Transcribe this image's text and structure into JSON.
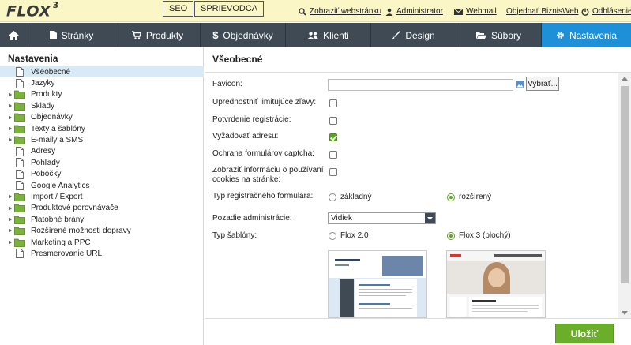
{
  "topbar": {
    "logo": "FLOX",
    "logo_version": "3",
    "btn_seo": "SEO",
    "btn_guide": "SPRIEVODCA",
    "links": {
      "view_site": "Zobraziť webstránku",
      "admin": "Administrator",
      "webmail": "Webmail",
      "order": "Objednať BiznisWeb",
      "logout": "Odhlásenie"
    }
  },
  "nav": {
    "tabs": [
      {
        "label": "Stránky",
        "icon": "page-icon"
      },
      {
        "label": "Produkty",
        "icon": "cart-icon"
      },
      {
        "label": "Objednávky",
        "icon": "dollar-icon"
      },
      {
        "label": "Klienti",
        "icon": "users-icon"
      },
      {
        "label": "Design",
        "icon": "brush-icon"
      },
      {
        "label": "Súbory",
        "icon": "folder-open-icon"
      },
      {
        "label": "Nastavenia",
        "icon": "gear-icon",
        "active": true
      }
    ]
  },
  "sidebar": {
    "title": "Nastavenia",
    "items": [
      {
        "label": "Všeobecné",
        "type": "page",
        "active": true
      },
      {
        "label": "Jazyky",
        "type": "page"
      },
      {
        "label": "Produkty",
        "type": "folder"
      },
      {
        "label": "Sklady",
        "type": "folder"
      },
      {
        "label": "Objednávky",
        "type": "folder"
      },
      {
        "label": "Texty a šablóny",
        "type": "folder"
      },
      {
        "label": "E-maily a SMS",
        "type": "folder"
      },
      {
        "label": "Adresy",
        "type": "page"
      },
      {
        "label": "Pohľady",
        "type": "page"
      },
      {
        "label": "Pobočky",
        "type": "page"
      },
      {
        "label": "Google Analytics",
        "type": "page"
      },
      {
        "label": "Import / Export",
        "type": "folder"
      },
      {
        "label": "Produktové porovnávače",
        "type": "folder"
      },
      {
        "label": "Platobné brány",
        "type": "folder"
      },
      {
        "label": "Rozšírené možnosti dopravy",
        "type": "folder"
      },
      {
        "label": "Marketing a PPC",
        "type": "folder"
      },
      {
        "label": "Presmerovanie URL",
        "type": "page"
      }
    ]
  },
  "main": {
    "title": "Všeobecné",
    "favicon": {
      "label": "Favicon:",
      "value": "",
      "button": "Vybrať..."
    },
    "checkboxes": [
      {
        "label": "Upredn­ostniť limitujúce zľavy:",
        "checked": false
      },
      {
        "label": "Potvrdenie registrácie:",
        "checked": false
      },
      {
        "label": "Vyžadovať adresu:",
        "checked": true
      },
      {
        "label": "Ochrana formulárov captcha:",
        "checked": false
      },
      {
        "label": "Zobraziť informáciu o používaní cookies na stránke:",
        "checked": false
      }
    ],
    "reg_form": {
      "label": "Typ registračného formulára:",
      "options": [
        "základný",
        "rozšírený"
      ],
      "selected": "rozšírený"
    },
    "admin_bg": {
      "label": "Pozadie administrácie:",
      "value": "Vidiek"
    },
    "template": {
      "label": "Typ šablóny:",
      "options": [
        "Flox 2.0",
        "Flox 3 (plochý)"
      ],
      "selected": "Flox 3 (plochý)"
    },
    "save": "Uložiť"
  },
  "colors": {
    "topbar_bg": "#fbf6c6",
    "nav_bg": "#3f4a55",
    "nav_active": "#1e90d8",
    "accent_green": "#6aae2a",
    "sidebar_active": "#d9eaf7"
  }
}
